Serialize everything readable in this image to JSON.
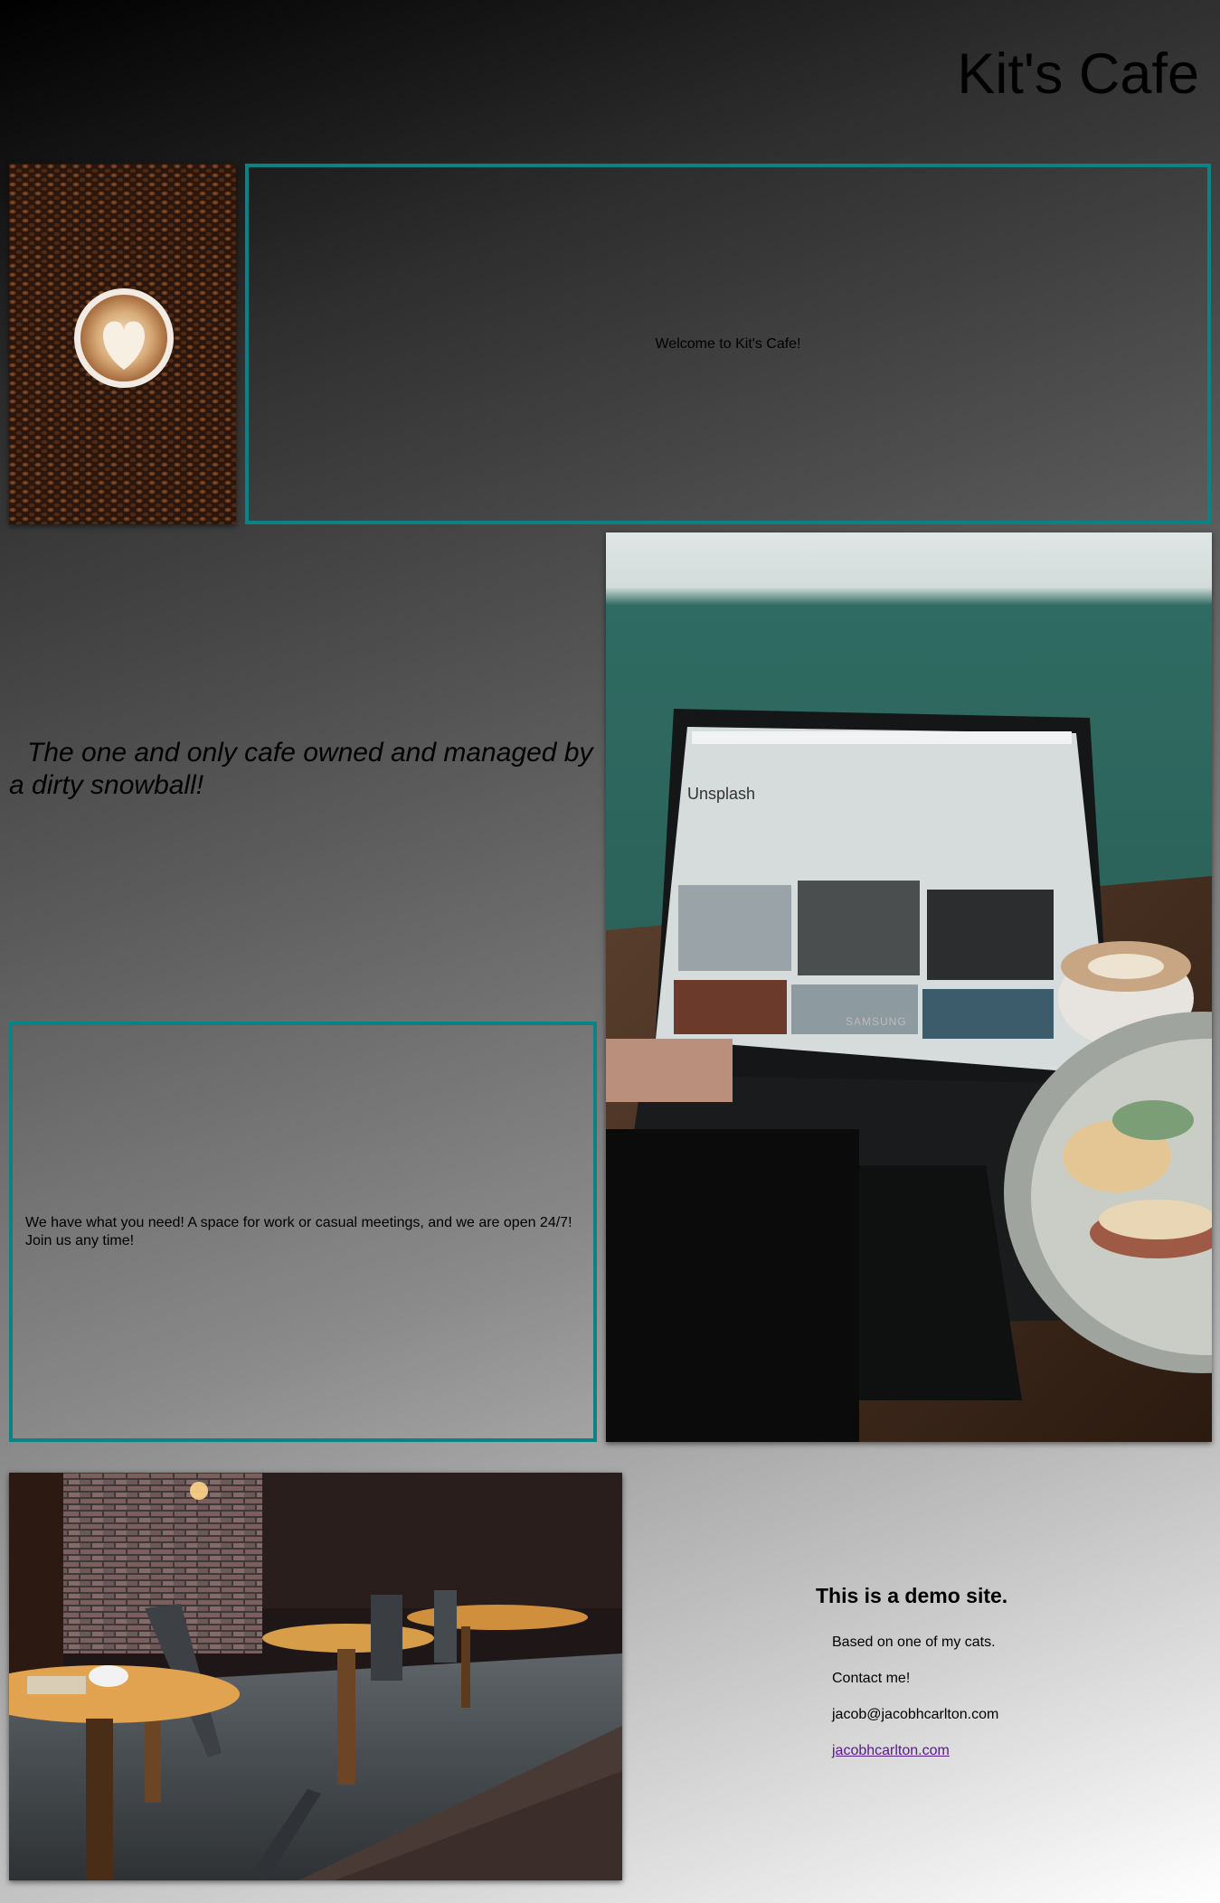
{
  "header": {
    "title": "Kit's Cafe"
  },
  "welcome": {
    "text": "Welcome to Kit's Cafe!"
  },
  "tagline": {
    "text": "The one and only cafe owned and managed by a dirty snowball!"
  },
  "services": {
    "text": "We have what you need! A space for work or casual meetings, and we are open 24/7! Join us any time!"
  },
  "laptop_screen": {
    "site_name": "Unsplash",
    "brand": "SAMSUNG"
  },
  "footer": {
    "heading": "This is a demo site.",
    "note": "Based on one of my cats.",
    "contact_label": "Contact me!",
    "email": "jacob@jacobhcarlton.com",
    "website": "jacobhcarlton.com"
  },
  "colors": {
    "accent": "#0a8385",
    "link_visited": "#551a8b"
  }
}
